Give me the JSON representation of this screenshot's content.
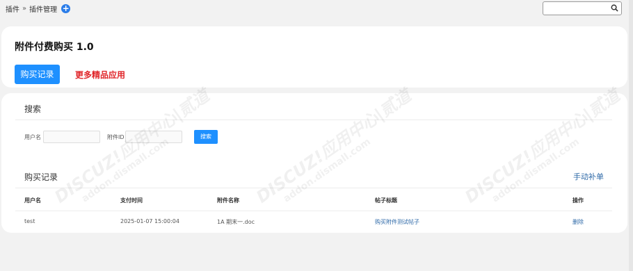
{
  "breadcrumb": {
    "item1": "插件",
    "separator": "»",
    "item2": "插件管理"
  },
  "search": {
    "value": "",
    "placeholder": ""
  },
  "plugin": {
    "title": "附件付费购买 1.0",
    "purchase_records_button": "购买记录",
    "more_apps_link": "更多精品应用"
  },
  "search_section": {
    "title": "搜索",
    "username_label": "用户名",
    "username_value": "",
    "attachment_id_label": "附件ID",
    "attachment_id_value": "",
    "search_button": "搜索"
  },
  "records_section": {
    "title": "购买记录",
    "manual_add_link": "手动补单",
    "columns": [
      "用户名",
      "支付时间",
      "附件名称",
      "帖子标题",
      "操作"
    ],
    "rows": [
      [
        "test",
        "2025-01-07 15:00:04",
        "1A 期末一.doc",
        "购买附件测试帖子",
        "删除"
      ]
    ]
  },
  "watermark": {
    "brand": "DISCUZ!应用中心|贰道",
    "site": "addon.dismall.com"
  },
  "colors": {
    "accent": "#1e90ff",
    "link_red": "#e0262a",
    "link_blue": "#2f6aa8"
  },
  "icons": {
    "add": "plus-circle-icon",
    "search": "search-icon"
  }
}
